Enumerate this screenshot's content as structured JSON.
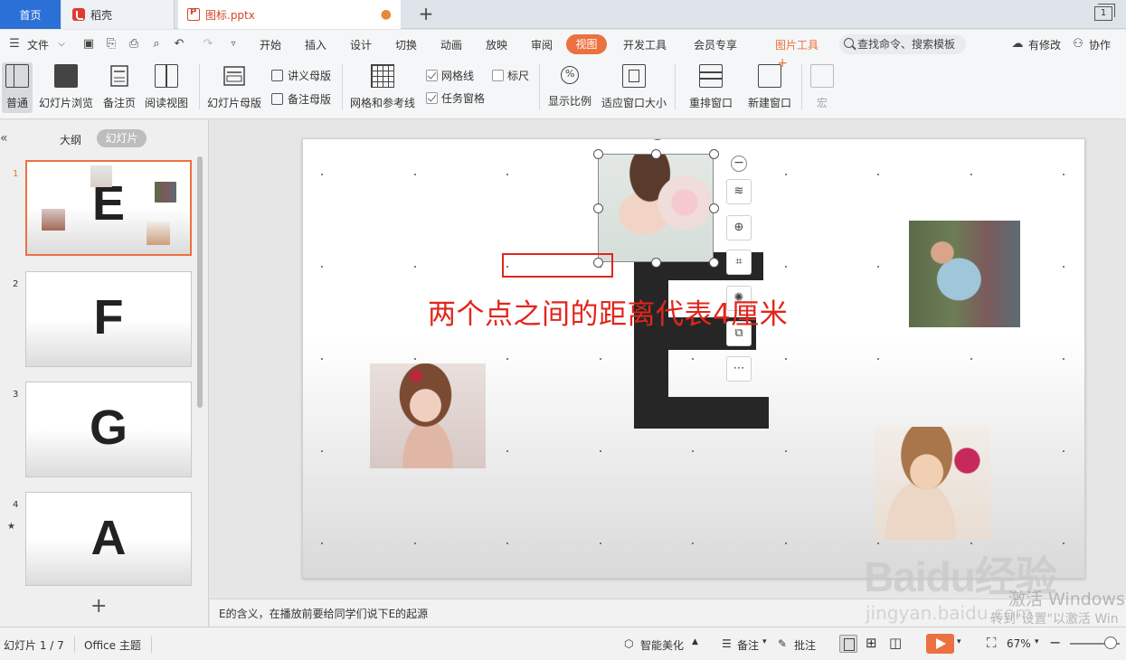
{
  "tabs": {
    "home": "首页",
    "daoke": "稻壳",
    "file": "图标.pptx",
    "window_count": "1"
  },
  "menu": {
    "file": "文件",
    "items": [
      "开始",
      "插入",
      "设计",
      "切换",
      "动画",
      "放映",
      "审阅",
      "视图",
      "开发工具",
      "会员专享",
      "图片工具"
    ],
    "search_placeholder": "查找命令、搜索模板",
    "modified": "有修改",
    "collab": "协作"
  },
  "ribbon": {
    "normal": "普通",
    "slide_browse": "幻灯片浏览",
    "notes_page": "备注页",
    "reading_view": "阅读视图",
    "slide_master": "幻灯片母版",
    "handout_master": "讲义母版",
    "notes_master": "备注母版",
    "grid_guides": "网格和参考线",
    "gridlines": "网格线",
    "ruler": "标尺",
    "task_pane": "任务窗格",
    "zoom": "显示比例",
    "fit_window": "适应窗口大小",
    "rearrange": "重排窗口",
    "new_window": "新建窗口",
    "macro": "宏"
  },
  "left_panel": {
    "outline_tab": "大纲",
    "slides_tab": "幻灯片",
    "thumbnails": [
      {
        "num": "1",
        "letter": "E"
      },
      {
        "num": "2",
        "letter": "F"
      },
      {
        "num": "3",
        "letter": "G"
      },
      {
        "num": "4",
        "letter": "A"
      }
    ]
  },
  "slide": {
    "annotation": "两个点之间的距离代表4厘米"
  },
  "notes": {
    "text": "E的含义，在播放前要给同学们说下E的起源"
  },
  "status": {
    "slide_pos": "幻灯片 1 / 7",
    "theme": "Office 主题",
    "smart_beautify": "智能美化",
    "notes": "备注",
    "comments": "批注",
    "zoom": "67%"
  },
  "watermark": {
    "brand": "Baidu经验",
    "url": "jingyan.baidu.com",
    "win1": "激活 Windows",
    "win2": "转到\"设置\"以激活 Win"
  },
  "colors": {
    "accent": "#ec7140",
    "annotation": "#e1261c",
    "home_tab": "#2b70d6"
  }
}
